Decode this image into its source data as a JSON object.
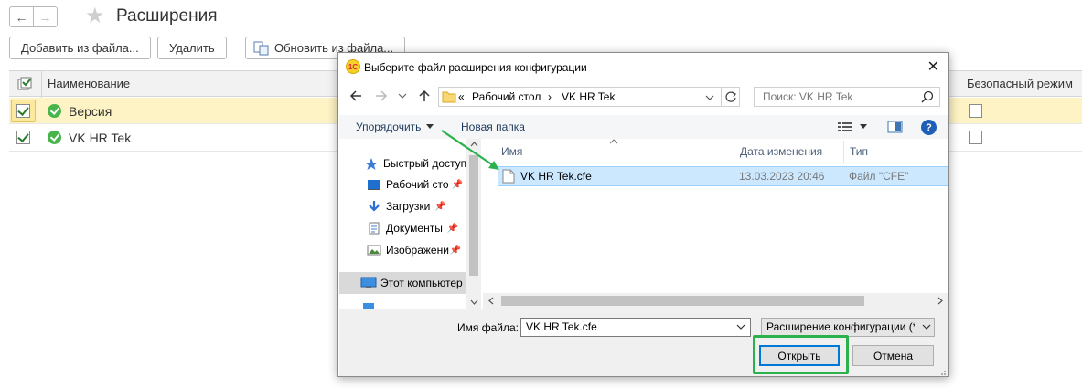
{
  "page": {
    "title": "Расширения",
    "nav_back": "←",
    "nav_forward": "→",
    "star": "★"
  },
  "toolbar": {
    "add_from_file": "Добавить из файла...",
    "delete": "Удалить",
    "update_from_file": "Обновить из файла..."
  },
  "grid": {
    "columns": {
      "name": "Наименование",
      "safe_mode": "Безопасный режим"
    },
    "rows": [
      {
        "name": "Версия",
        "checked": true,
        "selected": true
      },
      {
        "name": "VK HR Tek",
        "checked": true,
        "selected": false
      }
    ]
  },
  "dialog": {
    "title": "Выберите файл расширения конфигурации",
    "close": "✕",
    "address": {
      "prefix": "«",
      "sep": "›",
      "parts": [
        "Рабочий стол",
        "VK HR Tek"
      ]
    },
    "search_placeholder": "Поиск: VK HR Tek",
    "organize": "Упорядочить",
    "new_folder": "Новая папка",
    "help": "?",
    "nav": {
      "quick_access": "Быстрый доступ",
      "items": [
        "Рабочий сто",
        "Загрузки",
        "Документы",
        "Изображени"
      ],
      "this_pc": "Этот компьютер"
    },
    "columns": {
      "name": "Имя",
      "date": "Дата изменения",
      "type": "Тип"
    },
    "files": [
      {
        "name": "VK HR Tek.cfe",
        "date": "13.03.2023 20:46",
        "type": "Файл \"CFE\""
      }
    ],
    "filename_label": "Имя файла:",
    "filename_value": "VK HR Tek.cfe",
    "filter_value": "Расширение конфигурации (*",
    "open_button": "Открыть",
    "cancel_button": "Отмена"
  },
  "colors": {
    "selected_row": "#fdf3c4",
    "file_selected": "#cce8ff",
    "annotation_green": "#2bb24c",
    "ok_green": "#48b54a"
  }
}
